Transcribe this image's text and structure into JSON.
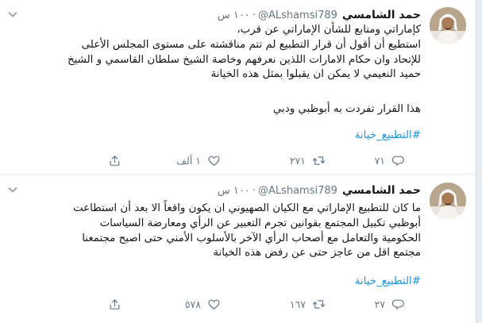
{
  "tweets": [
    {
      "name": "حمد الشامسي",
      "handle": "@ALshamsi789",
      "dot": "·",
      "time": "١٠٠ س",
      "lines": [
        "كإماراتي ومتابع للشأن الإماراتي عن قرب،",
        "استطيع أن أقول أن قرار التطبيع لم تتم مناقشته على مستوى المجلس الأعلى",
        "للإتحاد وان حكام الامارات اللذين نعرفهم وخاصة الشيخ سلطان القاسمي و الشيخ",
        "حميد النعيمي لا يمكن ان يقبلوا بمثل هذه الخيانة",
        "",
        "هذا القرار تفردت به أبوظبي ودبي"
      ],
      "hashtag": "#التطبيع_خيانة",
      "replies": "٧١",
      "retweets": "٢٧١",
      "likes": "١ ألف"
    },
    {
      "name": "حمد الشامسي",
      "handle": "@ALshamsi789",
      "dot": "·",
      "time": "١٠٠ س",
      "lines": [
        "ما كان للتطبيع الإماراتي مع الكيان الصهيوني ان يكون واقعاً الا بعد أن استطاعت",
        "أبوظبي تكبيل المجتمع بقوانين تجرم التعبير عن الرأي ومعارضة السياسات",
        "الحكومية والتعامل مع أصحاب الرأي الآخر بالأسلوب الأمني حتى اصبح مجتمعنا",
        "مجتمع اقل من عاجز  حتى عن رفض هذه الخيانة"
      ],
      "hashtag": "#التطبيع_خيانة",
      "replies": "٢٧",
      "retweets": "١٦٧",
      "likes": "٥٧٨"
    }
  ]
}
